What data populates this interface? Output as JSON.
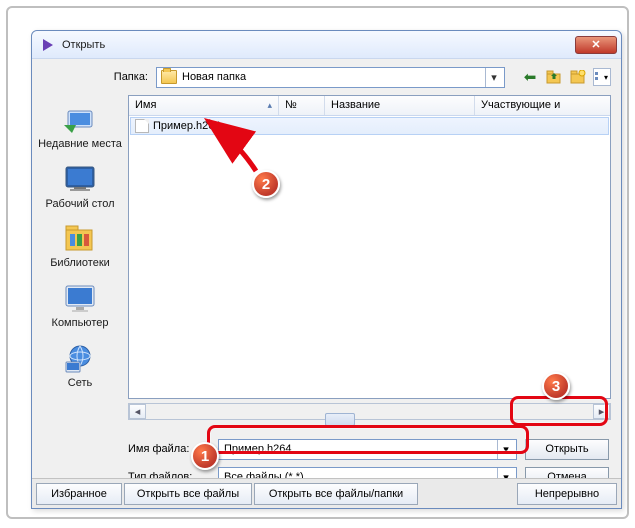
{
  "title": "Открыть",
  "folder": {
    "label": "Папка:",
    "value": "Новая папка"
  },
  "sidebar": {
    "recent": "Недавние места",
    "desktop": "Рабочий стол",
    "libraries": "Библиотеки",
    "computer": "Компьютер",
    "network": "Сеть"
  },
  "columns": {
    "name": "Имя",
    "no": "№",
    "title": "Название",
    "participants": "Участвующие и"
  },
  "file": {
    "name": "Пример.h264"
  },
  "filename": {
    "label": "Имя файла:",
    "value": "Пример.h264"
  },
  "filetype": {
    "label": "Тип файлов:",
    "value": "Все файлы (*.*)"
  },
  "buttons": {
    "open": "Открыть",
    "cancel": "Отмена"
  },
  "bottom": {
    "favorites": "Избранное",
    "open_files": "Открыть все файлы",
    "open_folders": "Открыть все файлы/папки",
    "continuous": "Непрерывно"
  },
  "badges": {
    "b1": "1",
    "b2": "2",
    "b3": "3"
  }
}
